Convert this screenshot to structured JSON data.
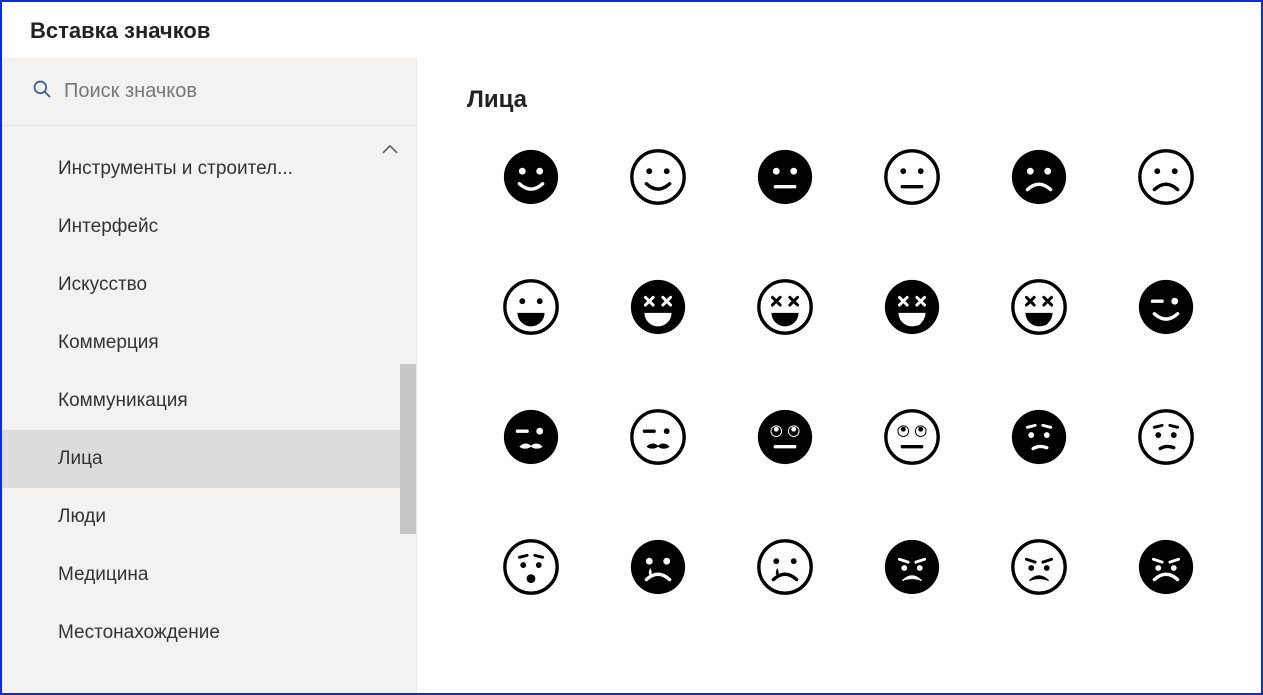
{
  "header": {
    "title": "Вставка значков"
  },
  "search": {
    "placeholder": "Поиск значков"
  },
  "sidebar": {
    "categories": [
      {
        "label": "Инструменты и строител...",
        "selected": false
      },
      {
        "label": "Интерфейс",
        "selected": false
      },
      {
        "label": "Искусство",
        "selected": false
      },
      {
        "label": "Коммерция",
        "selected": false
      },
      {
        "label": "Коммуникация",
        "selected": false
      },
      {
        "label": "Лица",
        "selected": true
      },
      {
        "label": "Люди",
        "selected": false
      },
      {
        "label": "Медицина",
        "selected": false
      },
      {
        "label": "Местонахождение",
        "selected": false
      }
    ]
  },
  "main": {
    "title": "Лица",
    "icons": [
      {
        "name": "smile-solid-icon"
      },
      {
        "name": "smile-outline-icon"
      },
      {
        "name": "neutral-solid-icon"
      },
      {
        "name": "neutral-outline-icon"
      },
      {
        "name": "frown-solid-icon"
      },
      {
        "name": "frown-outline-icon"
      },
      {
        "name": "grin-outline-icon"
      },
      {
        "name": "laugh-solid-icon"
      },
      {
        "name": "laugh-outline-icon"
      },
      {
        "name": "tongue-solid-icon"
      },
      {
        "name": "tongue-outline-icon"
      },
      {
        "name": "wink-solid-icon"
      },
      {
        "name": "mustache-wink-solid-icon"
      },
      {
        "name": "mustache-wink-outline-icon"
      },
      {
        "name": "eyeroll-solid-icon"
      },
      {
        "name": "eyeroll-outline-icon"
      },
      {
        "name": "worried-solid-icon"
      },
      {
        "name": "worried-outline-icon"
      },
      {
        "name": "surprised-outline-icon"
      },
      {
        "name": "cry-solid-icon"
      },
      {
        "name": "tear-outline-icon"
      },
      {
        "name": "sad-solid-icon"
      },
      {
        "name": "sad-outline-icon"
      },
      {
        "name": "angry-solid-icon"
      }
    ]
  }
}
